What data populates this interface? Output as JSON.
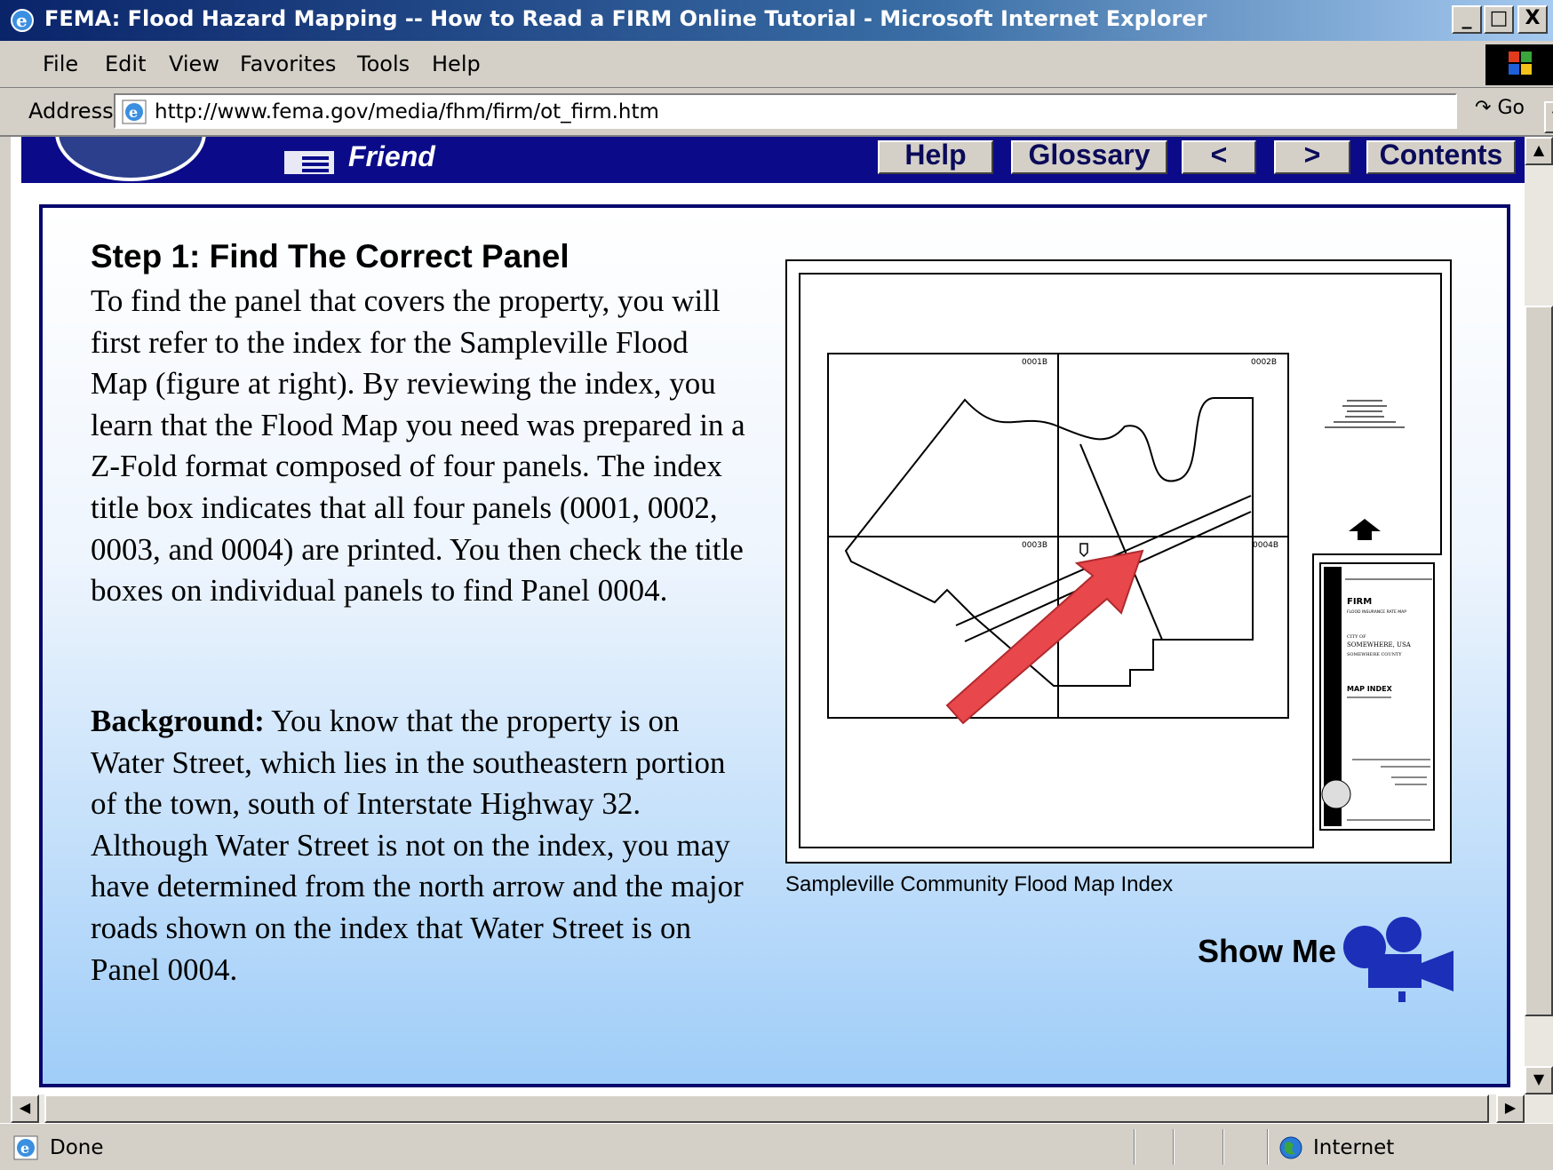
{
  "window": {
    "title": "FEMA: Flood Hazard Mapping -- How to Read a FIRM Online Tutorial - Microsoft Internet Explorer",
    "controls": [
      "_",
      "□",
      "X"
    ]
  },
  "menu": {
    "items": [
      "File",
      "Edit",
      "View",
      "Favorites",
      "Tools",
      "Help"
    ]
  },
  "address": {
    "label": "Address",
    "url": "http://www.fema.gov/media/fhm/firm/ot_firm.htm",
    "go_label": "Go"
  },
  "header": {
    "tell_a_friend": "Friend",
    "nav_buttons": [
      "Help",
      "Glossary",
      "<",
      ">",
      "Contents"
    ]
  },
  "content": {
    "step_title": "Step 1: Find The Correct Panel",
    "paragraph1": "To find the panel that covers the property, you will first refer to the index for the Sampleville Flood Map (figure at right). By reviewing the index, you learn that the Flood Map you need was prepared in a Z-Fold format composed of four panels. The index title box indicates that all four panels (0001, 0002, 0003, and 0004) are printed. You then check the title boxes on individual panels to find Panel 0004.",
    "background_label": "Background:",
    "paragraph2": "You know that the property is on Water Street, which lies in the southeastern portion of the town, south of Interstate Highway 32. Although Water Street is not on the index, you may have determined from the north arrow and the major roads shown on the index that Water Street is on Panel 0004.",
    "figure_caption": "Sampleville Community Flood Map Index",
    "show_me": "Show Me"
  },
  "figure": {
    "panel_labels": [
      "0001B",
      "0002B",
      "0003B",
      "0004B"
    ],
    "title_box": {
      "firm": "FIRM",
      "subtitle": "FLOOD INSURANCE RATE MAP",
      "city_of": "CITY OF",
      "city": "SOMEWHERE, USA",
      "county": "SOMEWHERE COUNTY",
      "map_index": "MAP INDEX"
    }
  },
  "statusbar": {
    "status": "Done",
    "zone": "Internet"
  },
  "colors": {
    "header": "#0b0b8a",
    "panel_border": "#06066b",
    "arrow": "#e8474b",
    "camera": "#1b2fb8"
  }
}
